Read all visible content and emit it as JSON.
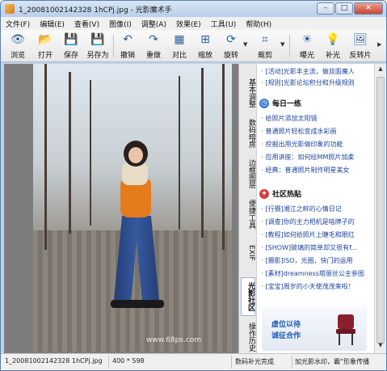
{
  "window": {
    "title": "1_20081002142328 1hCPj.jpg - 光影魔术手",
    "controls": {
      "minimize": "–",
      "maximize": "□",
      "close": "✕"
    }
  },
  "menubar": {
    "items": [
      "文件(F)",
      "编辑(E)",
      "查看(V)",
      "图像(I)",
      "调整(A)",
      "效果(E)",
      "工具(U)",
      "帮助(H)"
    ]
  },
  "toolbar": {
    "buttons": [
      {
        "label": "浏览",
        "icon": "browse-icon",
        "glyph": "👁"
      },
      {
        "label": "打开",
        "icon": "open-folder-icon",
        "glyph": "📂"
      },
      {
        "label": "保存",
        "icon": "save-icon",
        "glyph": "💾"
      },
      {
        "label": "另存为",
        "icon": "save-as-icon",
        "glyph": "💾"
      },
      {
        "label": "撤销",
        "icon": "undo-icon",
        "glyph": "↶"
      },
      {
        "label": "重做",
        "icon": "redo-icon",
        "glyph": "↷"
      },
      {
        "label": "对比",
        "icon": "compare-icon",
        "glyph": "▦"
      },
      {
        "label": "缩放",
        "icon": "zoom-icon",
        "glyph": "⊞"
      },
      {
        "label": "旋转",
        "icon": "rotate-icon",
        "glyph": "⟳"
      },
      {
        "label": "裁剪",
        "icon": "crop-icon",
        "glyph": "⌗"
      },
      {
        "label": "曝光",
        "icon": "exposure-icon",
        "glyph": "☀"
      },
      {
        "label": "补光",
        "icon": "fill-light-icon",
        "glyph": "💡"
      },
      {
        "label": "反转片",
        "icon": "slide-film-icon",
        "glyph": "🖼"
      }
    ]
  },
  "image": {
    "watermark": "www.68ps.com"
  },
  "side_tabs": [
    {
      "label": "基本调整",
      "active": false
    },
    {
      "label": "数码暗房",
      "active": false
    },
    {
      "label": "边框图层",
      "active": false
    },
    {
      "label": "便捷工具",
      "active": false
    },
    {
      "label": "EXIF",
      "active": false
    },
    {
      "label": "光影社区",
      "active": true
    },
    {
      "label": "操作历史",
      "active": false
    }
  ],
  "panel": {
    "top_links": [
      "[活动]光影丰主流，做双面魔人",
      "[规则]光影论坛积分和升级规则"
    ],
    "daily": {
      "title": "每日一练",
      "links": [
        "给照片添加太阳镜",
        "普通照片轻松变成水彩画",
        "挖掘出用光影做印象的功能",
        "应用讲座：如何绘MM照片加柔",
        "经典：普通照片制作明星美女"
      ]
    },
    "forum": {
      "title": "社区热贴",
      "links": [
        "[行摄]湘江之畔的心情日记",
        "[调查]你的主力相机是啥牌子的",
        "[教程]如何给照片上睫毛和眼红",
        "[SHOW]玻璃的简单却又很有f...",
        "[摄影]ISO，光圈，快门的运用",
        "[素材]dreamness塔丽丝公主参图",
        "[宝宝]周岁的小天使茂茂来啦！"
      ]
    },
    "ad": {
      "line1": "虚位以待",
      "line2": "诚征合作"
    }
  },
  "statusbar": {
    "filename": "1_20081002142328 1hCPj.jpg",
    "dimensions": "400 * 598",
    "action": "数码补光完成",
    "hint": "加光影水印，霸“形象传播"
  }
}
